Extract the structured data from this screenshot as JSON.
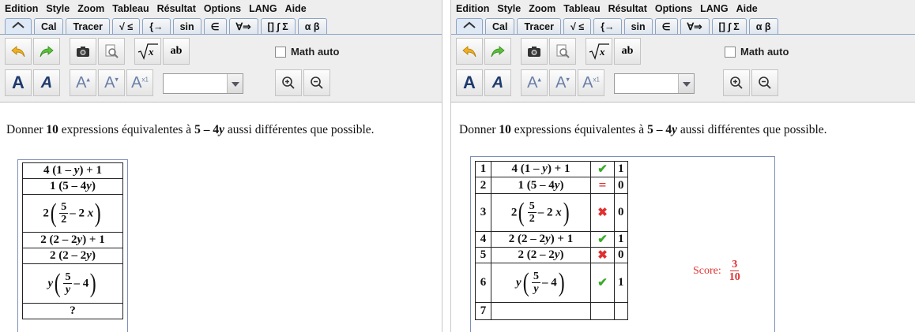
{
  "menu": [
    "Edition",
    "Style",
    "Zoom",
    "Tableau",
    "Résultat",
    "Options",
    "LANG",
    "Aide"
  ],
  "tabs": [
    "Cal",
    "Tracer",
    "√ ≤",
    "{→",
    "sin",
    "∈",
    "∀⇒",
    "[] ∫ Σ",
    "α β"
  ],
  "toolbar": {
    "ab_label": "ab",
    "math_auto_label": "Math auto"
  },
  "problem": {
    "prefix": "Donner",
    "count": "10",
    "middle": "expressions équivalentes à",
    "expr": "5 – 4",
    "expr_var": "y",
    "suffix": "aussi différentes que possible."
  },
  "left_rows": {
    "r1": {
      "a": "4 (1 – ",
      "v": "y",
      "b": ") + 1"
    },
    "r2": {
      "a": "1 (5 – 4",
      "v": "y",
      "b": ")"
    },
    "r3": {
      "pre": "2",
      "num": "5",
      "den": "2",
      "mid": "– 2",
      "v": "x"
    },
    "r4": {
      "a": "2 (2 – 2",
      "v": "y",
      "b": ") + 1"
    },
    "r5": {
      "a": "2 (2 – 2",
      "v": "y",
      "b": ")"
    },
    "r6": {
      "pre": "y",
      "num": "5",
      "den": "y",
      "mid": "– 4"
    },
    "r7": "?"
  },
  "right_rows": {
    "idx": [
      "1",
      "2",
      "3",
      "4",
      "5",
      "6",
      "7"
    ],
    "marks": [
      "✔",
      "=",
      "✖",
      "✔",
      "✖",
      "✔",
      ""
    ],
    "scores": [
      "1",
      "0",
      "0",
      "1",
      "0",
      "1",
      ""
    ]
  },
  "score": {
    "label": "Score:",
    "num": "3",
    "den": "10"
  },
  "colors": {
    "ok": "#3aaa2a",
    "bad": "#e03030",
    "score": "#e03030"
  }
}
